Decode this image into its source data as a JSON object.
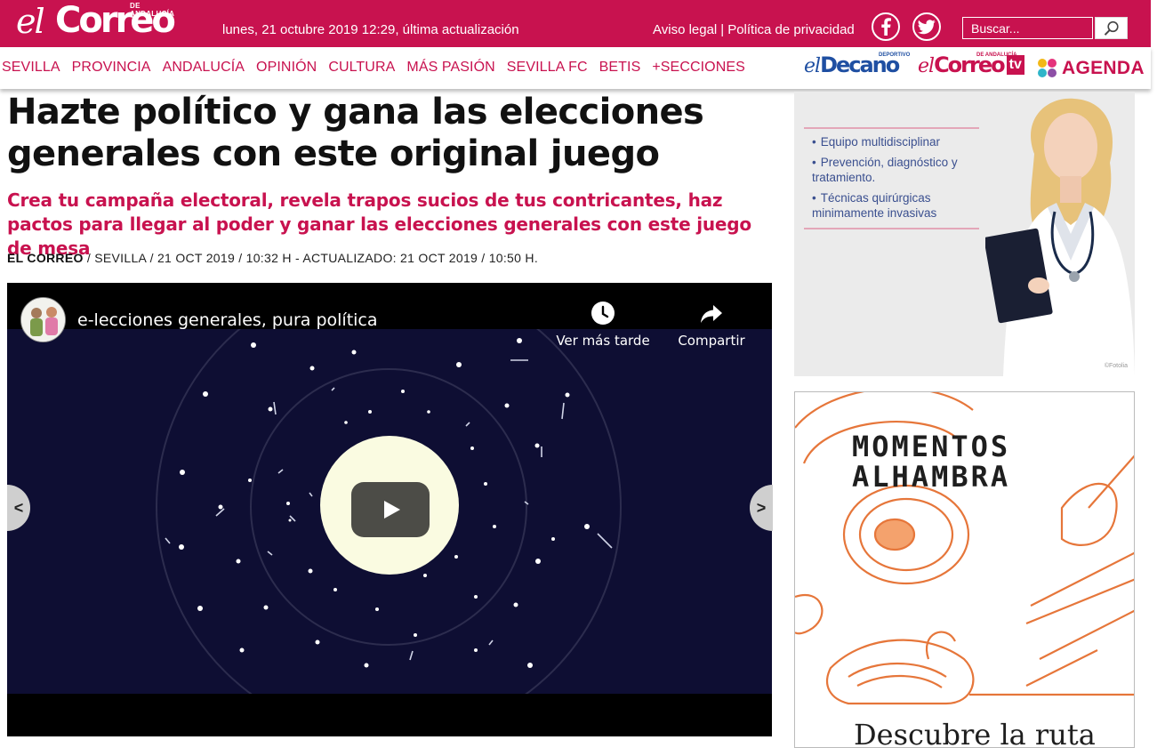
{
  "header": {
    "logo_el": "el",
    "logo_main": "Correo",
    "logo_sub": "DE ANDALUCÍA",
    "date_text": "lunes, 21 octubre 2019  12:29, última actualización",
    "legal_link": "Aviso legal",
    "legal_sep": "|",
    "privacy_link": "Política de privacidad",
    "search_placeholder": "Buscar...",
    "bg_color": "#c8124f"
  },
  "nav": {
    "items": [
      "SEVILLA",
      "PROVINCIA",
      "ANDALUCÍA",
      "OPINIÓN",
      "CULTURA",
      "MÁS PASIÓN",
      "SEVILLA FC",
      "BETIS",
      "+SECCIONES"
    ],
    "decano": {
      "el": "el",
      "main": "Decano",
      "tag": "DEPORTIVO"
    },
    "correo_tv": {
      "el": "el",
      "main": "Correo",
      "tv": "tv",
      "tag": "DE ANDALUCÍA"
    },
    "agenda": "AGENDA"
  },
  "article": {
    "headline": "Hazte político y gana las elecciones generales con este original juego",
    "subtitle": "Crea tu campaña electoral, revela trapos sucios de tus contricantes, haz pactos para llegar al poder y ganar las elecciones generales con este juego de mesa",
    "byline_source": "EL CORREO",
    "byline_rest": " / SEVILLA /  21 OCT 2019 / 10:32 H - ACTUALIZADO: 21 OCT 2019 / 10:50 H."
  },
  "video": {
    "title": "e-lecciones generales, pura política",
    "watch_later": "Ver más tarde",
    "share": "Compartir"
  },
  "carousel": {
    "prev": "<",
    "next": ">"
  },
  "ads": {
    "clinic_items": [
      "Equipo multidisciplinar",
      "Prevención, diagnóstico y tratamiento.",
      "Técnicas quirúrgicas minimamente invasivas"
    ],
    "clinic_credit": "©Fotolia",
    "alhambra_title_1": "MOMENTOS",
    "alhambra_title_2": "ALHAMBRA",
    "alhambra_cta": "Descubre la ruta"
  }
}
